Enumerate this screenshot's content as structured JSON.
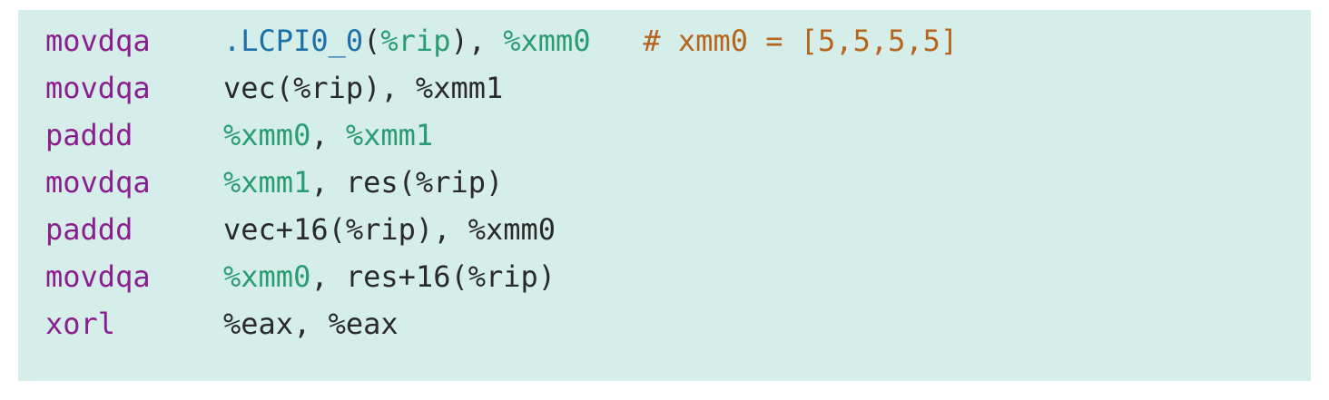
{
  "code_lines": [
    {
      "mnemonic": "movdqa",
      "tokens": [
        {
          "text": ".LCPI0_0",
          "kind": "symbol"
        },
        {
          "text": "(",
          "kind": "plain"
        },
        {
          "text": "%rip",
          "kind": "reg"
        },
        {
          "text": "), ",
          "kind": "plain"
        },
        {
          "text": "%xmm0",
          "kind": "reg"
        },
        {
          "text": "   # xmm0 = [5,5,5,5]",
          "kind": "comment"
        }
      ]
    },
    {
      "mnemonic": "movdqa",
      "tokens": [
        {
          "text": "vec(%rip), %xmm1",
          "kind": "plain"
        }
      ]
    },
    {
      "mnemonic": "paddd",
      "tokens": [
        {
          "text": "%xmm0",
          "kind": "reg"
        },
        {
          "text": ", ",
          "kind": "plain"
        },
        {
          "text": "%xmm1",
          "kind": "reg"
        }
      ]
    },
    {
      "mnemonic": "movdqa",
      "tokens": [
        {
          "text": "%xmm1",
          "kind": "reg"
        },
        {
          "text": ", res(%rip)",
          "kind": "plain"
        }
      ]
    },
    {
      "mnemonic": "paddd",
      "tokens": [
        {
          "text": "vec+16(%rip), %xmm0",
          "kind": "plain"
        }
      ]
    },
    {
      "mnemonic": "movdqa",
      "tokens": [
        {
          "text": "%xmm0",
          "kind": "reg"
        },
        {
          "text": ", res+16(%rip)",
          "kind": "plain"
        }
      ]
    },
    {
      "mnemonic": "xorl",
      "tokens": [
        {
          "text": "%eax, %eax",
          "kind": "plain"
        }
      ]
    }
  ],
  "colors": {
    "background": "#d6eeea",
    "mnemonic": "#8b1e8f",
    "plain": "#2a2a2a",
    "symbol": "#1d6fa8",
    "register": "#2a9c74",
    "comment": "#b5651d"
  }
}
